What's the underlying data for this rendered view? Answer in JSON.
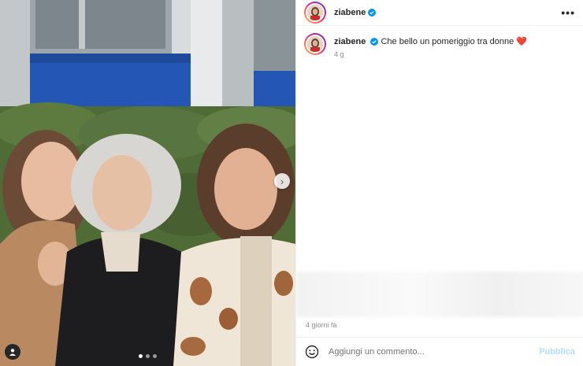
{
  "post": {
    "username": "ziabene",
    "verified": true,
    "more_icon": "more-horizontal-icon",
    "caption": {
      "username": "ziabene",
      "text": "Che bello un pomeriggio tra donne",
      "emoji": "❤️",
      "time": "4 g"
    },
    "date_label": "4 giorni fa"
  },
  "carousel": {
    "slide_count": 3,
    "active_slide": 1,
    "next_icon": "chevron-right-icon",
    "tag_icon": "user-tag-icon"
  },
  "comment": {
    "placeholder": "Aggiungi un commento...",
    "publish_label": "Pubblica",
    "emoji_icon": "smiley-icon"
  },
  "colors": {
    "verified_blue": "#0095f6",
    "publish_disabled": "#b2dffc",
    "heart": "#ed4956"
  }
}
